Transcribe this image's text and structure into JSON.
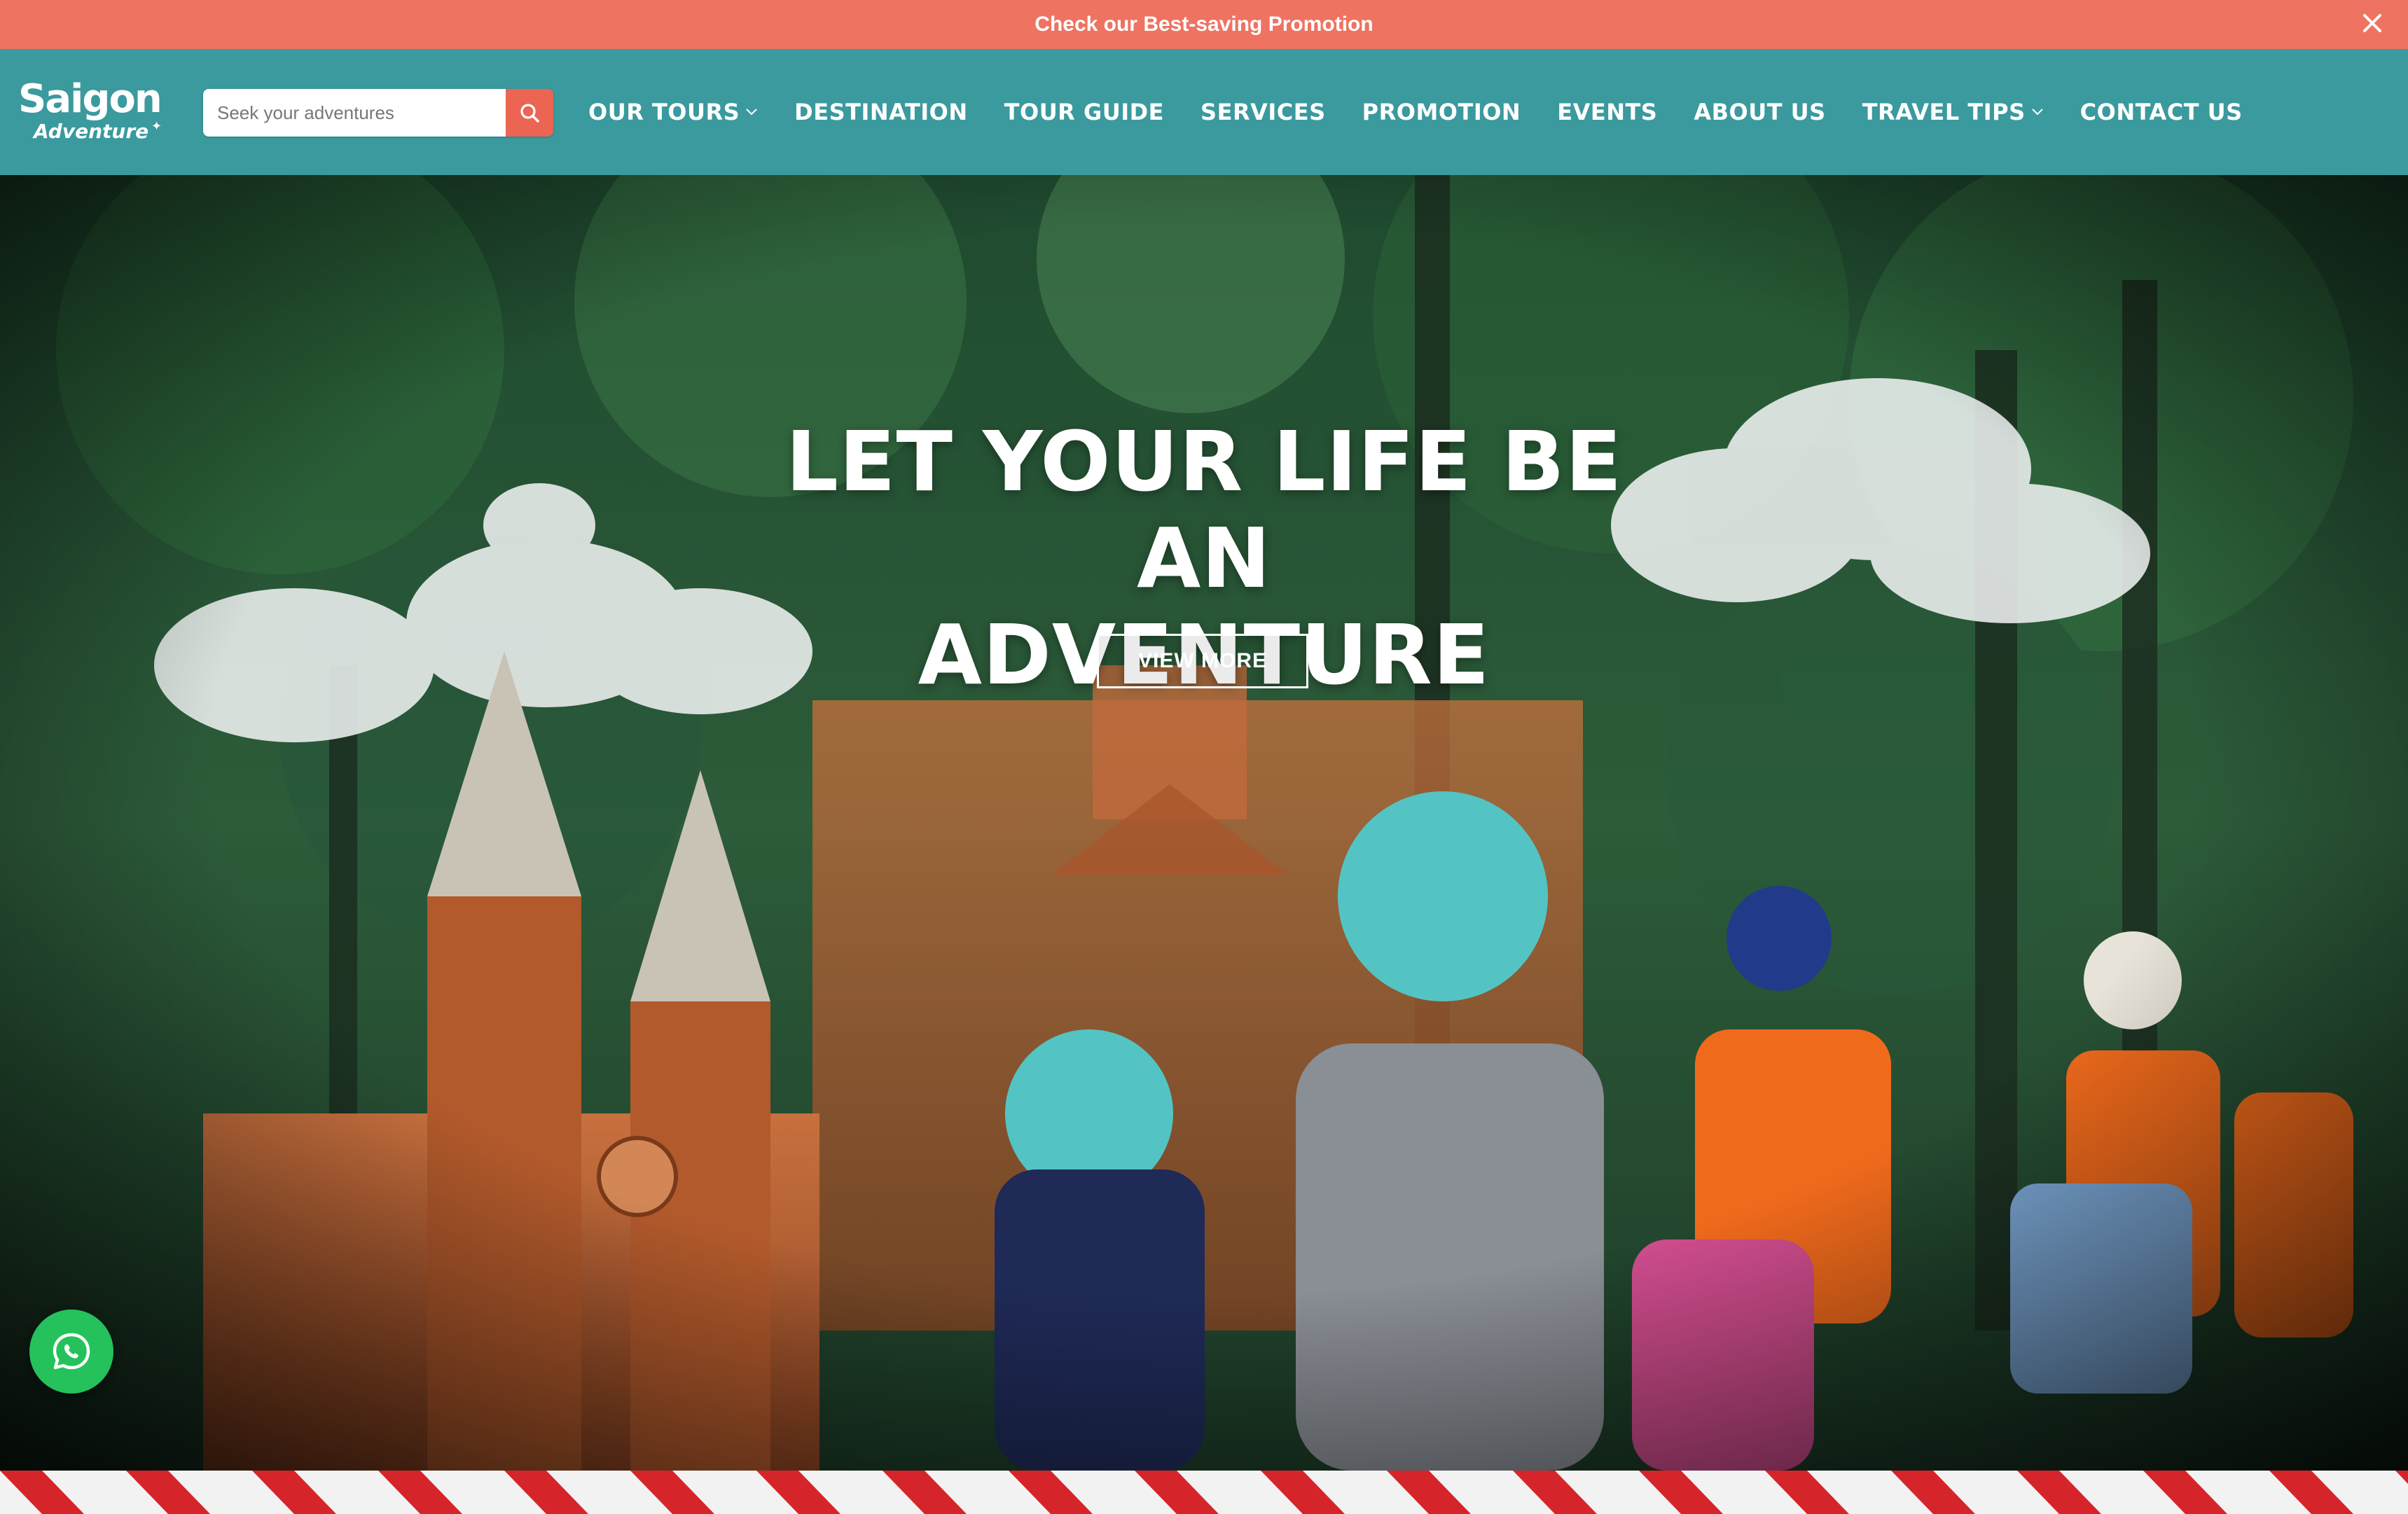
{
  "promo_bar": {
    "text": "Check our Best-saving Promotion",
    "close_icon": "close-icon"
  },
  "header": {
    "logo": {
      "main": "Saigon",
      "sub": "Adventure"
    },
    "search": {
      "placeholder": "Seek your adventures",
      "value": "",
      "icon": "search-icon"
    },
    "nav_items": [
      {
        "label": "OUR TOURS",
        "dropdown": true
      },
      {
        "label": "DESTINATION",
        "dropdown": false
      },
      {
        "label": "TOUR GUIDE",
        "dropdown": false
      },
      {
        "label": "SERVICES",
        "dropdown": false
      },
      {
        "label": "PROMOTION",
        "dropdown": false
      },
      {
        "label": "EVENTS",
        "dropdown": false
      },
      {
        "label": "ABOUT US",
        "dropdown": false
      },
      {
        "label": "TRAVEL TIPS",
        "dropdown": true
      },
      {
        "label": "CONTACT US",
        "dropdown": false
      }
    ]
  },
  "hero": {
    "title_line1": "LET YOUR LIFE BE AN",
    "title_line2": "ADVENTURE",
    "cta_label": "VIEW MORE"
  },
  "floating": {
    "whatsapp_icon": "whatsapp-icon"
  },
  "colors": {
    "promo_bg": "#ee7361",
    "nav_bg": "#3a9a9e",
    "search_button": "#ec6553",
    "whatsapp": "#25c15a",
    "stripe_red": "#d6252a"
  }
}
